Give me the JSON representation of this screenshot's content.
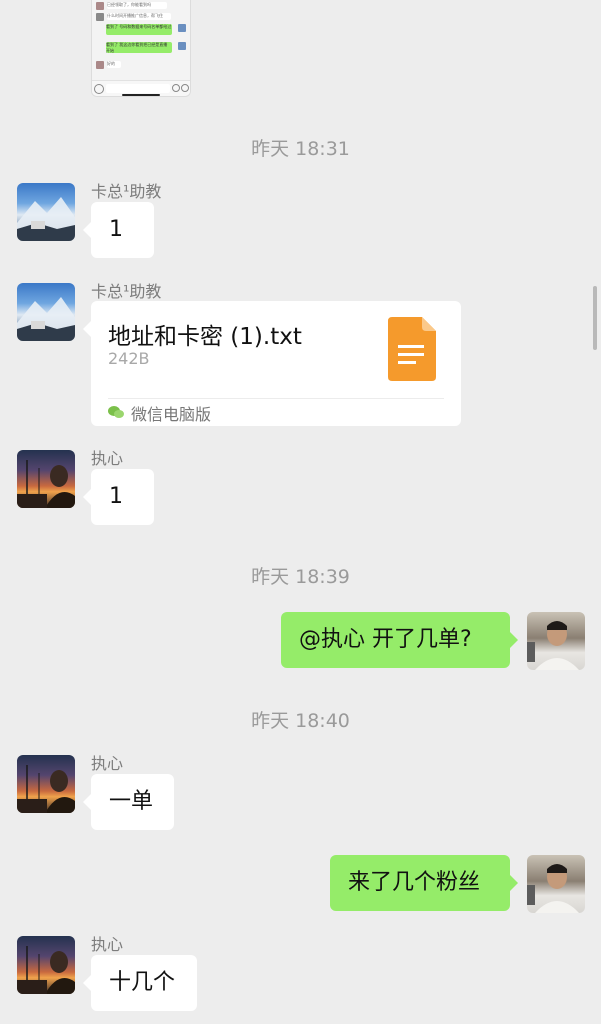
{
  "thumbnail": {
    "lines": [
      "已经领取了，你能看到吗",
      "什么时间开播推广信息，帮飞住",
      "看到了 号码和数据来号码名单都给过",
      "看到了 我这边你看到把已经是直播 开始",
      "好的"
    ]
  },
  "timestamps": [
    "昨天 18:31",
    "昨天 18:39",
    "昨天 18:40"
  ],
  "messages": [
    {
      "sender": "卡总¹助教",
      "text": "1"
    },
    {
      "sender": "卡总¹助教",
      "file": {
        "name": "地址和卡密 (1).txt",
        "size": "242B",
        "source": "微信电脑版"
      }
    },
    {
      "sender": "执心",
      "text": "1"
    },
    {
      "outgoing": true,
      "text": "@执心 开了几单?"
    },
    {
      "sender": "执心",
      "text": "一单"
    },
    {
      "outgoing": true,
      "text": "来了几个粉丝"
    },
    {
      "sender": "执心",
      "text": "十几个"
    }
  ],
  "colors": {
    "background": "#ededed",
    "outgoing_bubble": "#95ec69",
    "file_icon": "#f59a2c"
  }
}
